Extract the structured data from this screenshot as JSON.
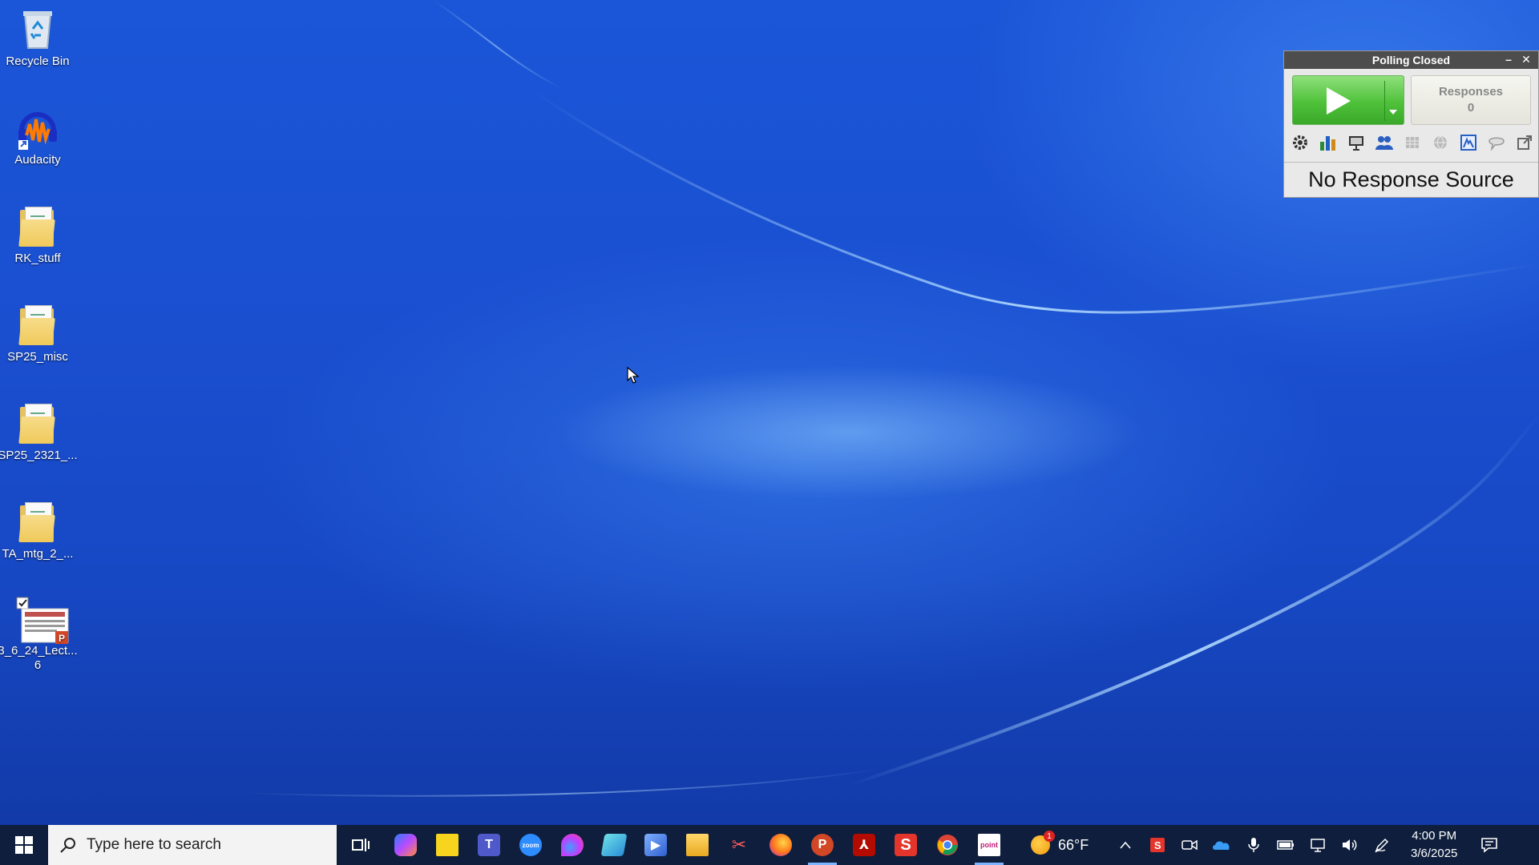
{
  "desktop": {
    "icons": [
      {
        "label": "Recycle Bin"
      },
      {
        "label": "Audacity"
      },
      {
        "label": "RK_stuff"
      },
      {
        "label": "SP25_misc"
      },
      {
        "label": "SP25_2321_..."
      },
      {
        "label": "TA_mtg_2_..."
      },
      {
        "label": "3_6_24_Lect...\n6"
      }
    ]
  },
  "poll_widget": {
    "title": "Polling Closed",
    "minimize_glyph": "–",
    "close_glyph": "✕",
    "responses_label": "Responses",
    "responses_count": "0",
    "response_source": "No Response Source",
    "toolbar_icons": [
      "gear-icon",
      "bar-chart-icon",
      "presentation-icon",
      "participants-icon",
      "grid-icon",
      "globe-icon",
      "image-icon",
      "speech-bubble-icon",
      "popout-icon"
    ]
  },
  "taskbar": {
    "search_placeholder": "Type here to search",
    "pinned_apps": [
      "copilot",
      "sticky-notes",
      "teams",
      "zoom",
      "paint",
      "notepad",
      "video",
      "file-explorer",
      "snipping-tool",
      "firefox",
      "powerpoint",
      "acrobat",
      "slides",
      "chrome",
      "pointsolutions"
    ],
    "weather_temp": "66°F",
    "time": "4:00 PM",
    "date": "3/6/2025"
  },
  "colors": {
    "taskbar_bg": "#0e1e3c",
    "poll_title_bg": "#4d4d4d",
    "start_green": "#4fc13a"
  }
}
